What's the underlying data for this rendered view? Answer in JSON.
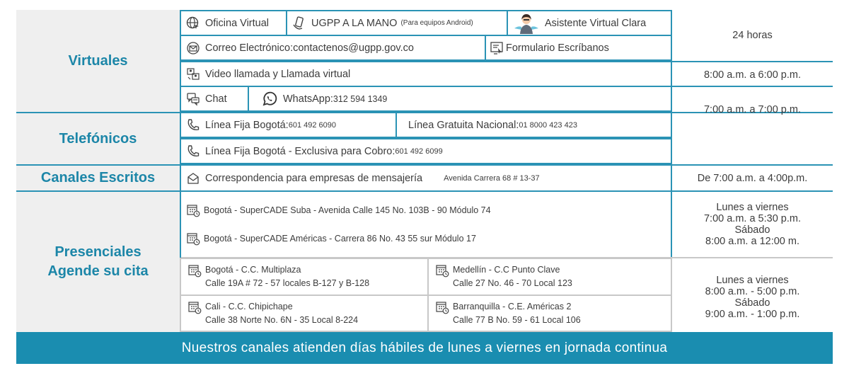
{
  "categories": {
    "virtuales": "Virtuales",
    "telefonicos": "Telefónicos",
    "escritos": "Canales Escritos",
    "presenciales_line1": "Presenciales",
    "presenciales_line2": "Agende su cita"
  },
  "virtual": {
    "oficina": "Oficina Virtual",
    "ugpp_app": "UGPP A LA MANO",
    "ugpp_app_note": "(Para equipos Android)",
    "asistente": "Asistente Virtual Clara",
    "correo_label": "Correo Electrónico: ",
    "correo_value": "contactenos@ugpp.gov.co",
    "formulario": "Formulario Escríbanos",
    "video": "Video llamada y Llamada virtual",
    "chat": "Chat",
    "whatsapp_label": "WhatsApp: ",
    "whatsapp_value": "312 594 1349"
  },
  "telefonos": {
    "fija_label": "Línea Fija Bogotá: ",
    "fija_value": "601 492 6090",
    "gratuita_label": "Línea Gratuita Nacional: ",
    "gratuita_value": "01 8000 423 423",
    "cobro_label": "Línea Fija Bogotá - Exclusiva para Cobro: ",
    "cobro_value": "601 492 6099"
  },
  "escritos": {
    "correspondencia": "Correspondencia para empresas de mensajería",
    "direccion": "Avenida Carrera 68 # 13-37"
  },
  "presenciales": {
    "suba": "Bogotá - SuperCADE Suba - Avenida Calle 145 No. 103B - 90 Módulo 74",
    "americas": "Bogotá - SuperCADE Américas - Carrera 86 No. 43 55 sur Módulo 17",
    "multiplaza_name": "Bogotá - C.C. Multiplaza",
    "multiplaza_addr": "Calle 19A # 72 - 57 locales B-127 y B-128",
    "medellin_name": "Medellín - C.C Punto Clave",
    "medellin_addr": "Calle 27 No. 46 - 70  Local 123",
    "cali_name": "Cali -  C.C. Chipichape",
    "cali_addr": "Calle 38 Norte No. 6N - 35 Local  8-224",
    "barranquilla_name": "Barranquilla - C.E. Américas 2",
    "barranquilla_addr": "Calle 77 B No. 59 - 61 Local 106"
  },
  "hours": {
    "h24": "24 horas",
    "video": "8:00 a.m. a 6:00 p.m.",
    "chat_tel": "7:00 a.m. a 7:00 p.m.",
    "escritos": "De 7:00 a.m. a 4:00p.m.",
    "cade_1": "Lunes a viernes",
    "cade_2": "7:00 a.m. a 5:30 p.m.",
    "cade_3": "Sábado",
    "cade_4": "8:00 a.m. a 12:00 m.",
    "cc_1": "Lunes a viernes",
    "cc_2": "8:00 a.m. - 5:00 p.m.",
    "cc_3": "Sábado",
    "cc_4": "9:00 a.m. - 1:00 p.m."
  },
  "footer": "Nuestros canales atienden días hábiles de lunes a viernes en jornada continua",
  "colors": {
    "accent": "#1c86a8",
    "border": "#2b93b5",
    "footer_bg": "#1a8db0",
    "category_bg": "#efefef"
  }
}
